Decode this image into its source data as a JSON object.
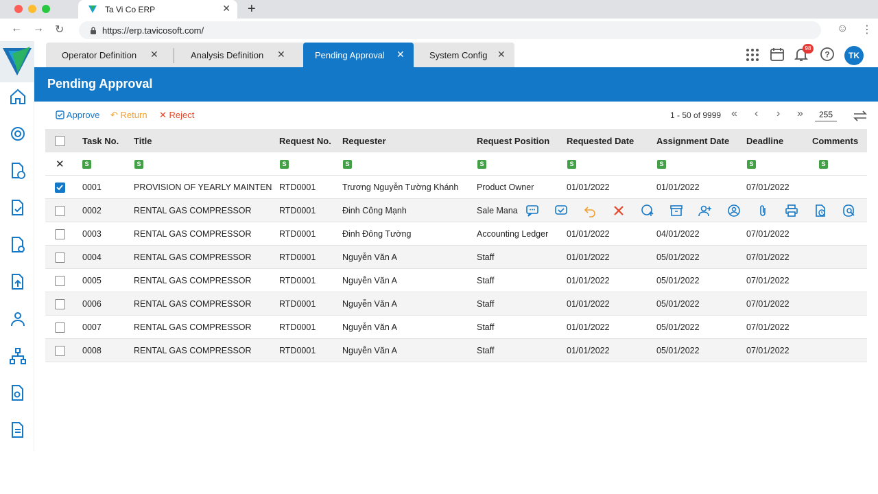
{
  "browser": {
    "tab_title": "Ta Vi Co ERP",
    "url": "https://erp.tavicosoft.com/"
  },
  "app_tabs": [
    {
      "label": "Operator Definition"
    },
    {
      "label": "Analysis Definition"
    },
    {
      "label": "Pending Approval"
    },
    {
      "label": "System Config"
    }
  ],
  "header": {
    "notification_count": "98",
    "avatar_initials": "TK"
  },
  "page": {
    "title": "Pending Approval"
  },
  "toolbar": {
    "approve": "Approve",
    "return": "Return",
    "reject": "Reject"
  },
  "pager": {
    "range": "1 - 50 of 9999",
    "page_size": "255"
  },
  "colors": {
    "primary": "#1478c8",
    "return": "#f0a030",
    "reject": "#e5472a",
    "filter_badge": "#43a047"
  },
  "table": {
    "columns": [
      "Task No.",
      "Title",
      "Request No.",
      "Requester",
      "Request Position",
      "Requested Date",
      "Assignment Date",
      "Deadline",
      "Comments"
    ],
    "filter_badge": "S",
    "rows": [
      {
        "task": "0001",
        "title": "PROVISION OF YEARLY MAINTENAN",
        "req_no": "RTD0001",
        "requester": "Trương Nguyễn Tường Khánh",
        "position": "Product Owner",
        "requested": "01/01/2022",
        "assigned": "01/01/2022",
        "deadline": "07/01/2022",
        "checked": true
      },
      {
        "task": "0002",
        "title": "RENTAL GAS COMPRESSOR",
        "req_no": "RTD0001",
        "requester": "Đinh Công Mạnh",
        "position": "Sale Mana",
        "requested": "",
        "assigned": "",
        "deadline": "",
        "checked": false
      },
      {
        "task": "0003",
        "title": "RENTAL GAS COMPRESSOR",
        "req_no": "RTD0001",
        "requester": "Đinh Đông Tường",
        "position": "Accounting Ledger",
        "requested": "01/01/2022",
        "assigned": "04/01/2022",
        "deadline": "07/01/2022",
        "checked": false
      },
      {
        "task": "0004",
        "title": "RENTAL GAS COMPRESSOR",
        "req_no": "RTD0001",
        "requester": "Nguyễn Văn A",
        "position": "Staff",
        "requested": "01/01/2022",
        "assigned": "05/01/2022",
        "deadline": "07/01/2022",
        "checked": false
      },
      {
        "task": "0005",
        "title": "RENTAL GAS COMPRESSOR",
        "req_no": "RTD0001",
        "requester": "Nguyễn Văn A",
        "position": "Staff",
        "requested": "01/01/2022",
        "assigned": "05/01/2022",
        "deadline": "07/01/2022",
        "checked": false
      },
      {
        "task": "0006",
        "title": "RENTAL GAS COMPRESSOR",
        "req_no": "RTD0001",
        "requester": "Nguyễn Văn A",
        "position": "Staff",
        "requested": "01/01/2022",
        "assigned": "05/01/2022",
        "deadline": "07/01/2022",
        "checked": false
      },
      {
        "task": "0007",
        "title": "RENTAL GAS COMPRESSOR",
        "req_no": "RTD0001",
        "requester": "Nguyễn Văn A",
        "position": "Staff",
        "requested": "01/01/2022",
        "assigned": "05/01/2022",
        "deadline": "07/01/2022",
        "checked": false
      },
      {
        "task": "0008",
        "title": "RENTAL GAS COMPRESSOR",
        "req_no": "RTD0001",
        "requester": "Nguyễn Văn A",
        "position": "Staff",
        "requested": "01/01/2022",
        "assigned": "05/01/2022",
        "deadline": "07/01/2022",
        "checked": false
      }
    ]
  },
  "row_actions": [
    "comment-icon",
    "approve-icon",
    "return-icon",
    "reject-icon",
    "forward-icon",
    "archive-icon",
    "add-user-icon",
    "reassign-icon",
    "attachment-icon",
    "print-icon",
    "history-icon",
    "search-doc-icon"
  ],
  "sidebar_icons": [
    "home-icon",
    "settings-icon",
    "doc-clock-icon",
    "doc-check-icon",
    "doc-gear-icon",
    "doc-upload-icon",
    "users-icon",
    "org-chart-icon",
    "doc-search-icon",
    "document-icon"
  ]
}
